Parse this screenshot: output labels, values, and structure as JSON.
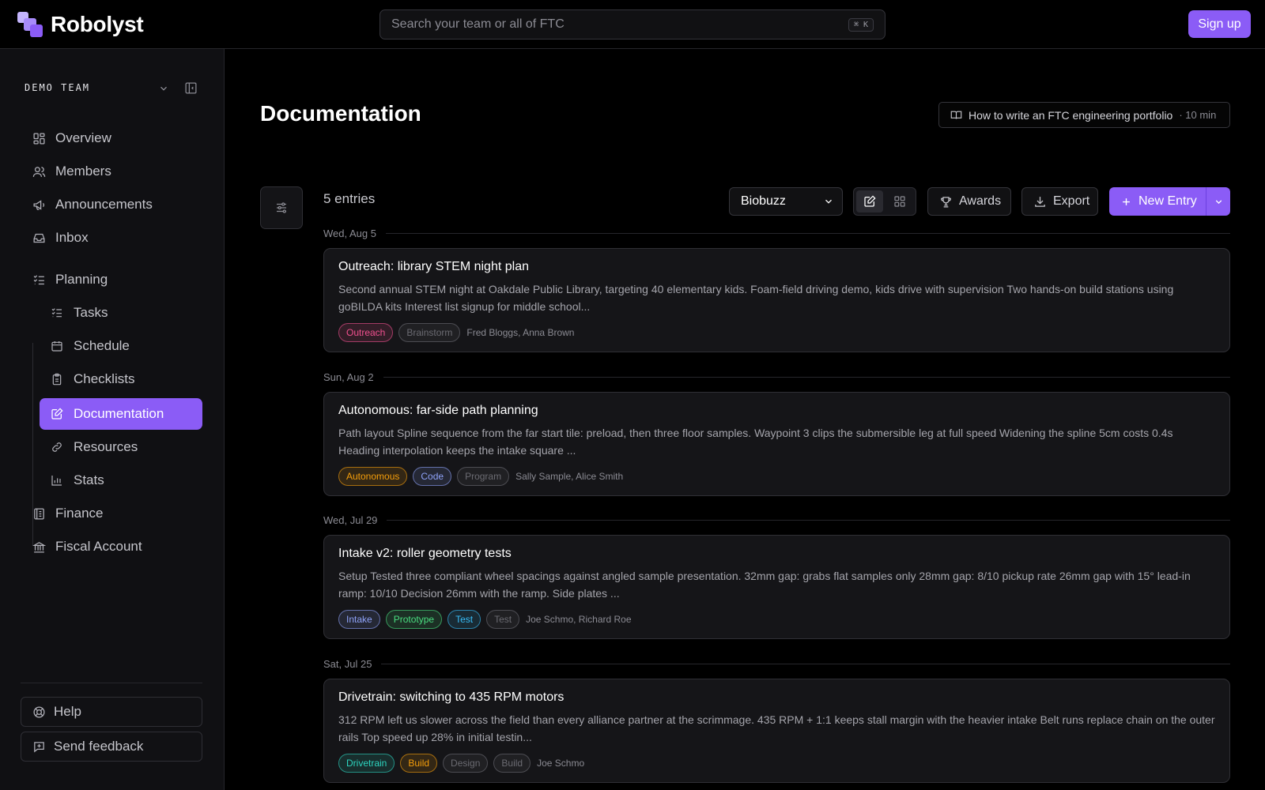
{
  "app": {
    "name": "Robolyst"
  },
  "search": {
    "placeholder": "Search your team or all of FTC",
    "shortcut": "⌘ K"
  },
  "header": {
    "signup_label": "Sign up"
  },
  "sidebar": {
    "team_name": "DEMO TEAM",
    "items": [
      {
        "key": "overview",
        "label": "Overview",
        "icon": "grid-icon"
      },
      {
        "key": "members",
        "label": "Members",
        "icon": "users-icon"
      },
      {
        "key": "announcements",
        "label": "Announcements",
        "icon": "megaphone-icon"
      },
      {
        "key": "inbox",
        "label": "Inbox",
        "icon": "inbox-icon"
      },
      {
        "key": "planning",
        "label": "Planning",
        "icon": "list-check-icon"
      },
      {
        "key": "tasks",
        "label": "Tasks",
        "icon": "list-check-icon"
      },
      {
        "key": "schedule",
        "label": "Schedule",
        "icon": "calendar-icon"
      },
      {
        "key": "checklists",
        "label": "Checklists",
        "icon": "clipboard-icon"
      },
      {
        "key": "documentation",
        "label": "Documentation",
        "icon": "edit-icon",
        "active": true
      },
      {
        "key": "resources",
        "label": "Resources",
        "icon": "link-icon"
      },
      {
        "key": "stats",
        "label": "Stats",
        "icon": "bar-chart-icon"
      },
      {
        "key": "finance",
        "label": "Finance",
        "icon": "ledger-icon"
      },
      {
        "key": "fiscal",
        "label": "Fiscal Account",
        "icon": "bank-icon"
      }
    ],
    "help_label": "Help",
    "feedback_label": "Send feedback"
  },
  "main": {
    "title": "Documentation",
    "guide": {
      "label": "How to write an FTC engineering portfolio",
      "duration": "· 10 min"
    },
    "entries_count": "5 entries",
    "season_select": {
      "value": "Biobuzz"
    },
    "toolbar": {
      "awards_label": "Awards",
      "export_label": "Export",
      "new_entry_label": "New Entry"
    },
    "groups": [
      {
        "date": "Wed, Aug 5",
        "entry": {
          "title": "Outreach: library STEM night plan",
          "body": "Second annual STEM night at Oakdale Public Library, targeting 40 elementary kids. Foam-field driving demo, kids drive with supervision Two hands-on build stations using goBILDA kits Interest list signup for middle school...",
          "tags": [
            {
              "label": "Outreach",
              "color": "#f0508f"
            },
            {
              "label": "Brainstorm",
              "color": "#6b6b72"
            }
          ],
          "people": "Fred Bloggs, Anna Brown"
        }
      },
      {
        "date": "Sun, Aug 2",
        "entry": {
          "title": "Autonomous: far-side path planning",
          "body": "Path layout Spline sequence from the far start tile: preload, then three floor samples. Waypoint 3 clips the submersible leg at full speed Widening the spline 5cm costs 0.4s Heading interpolation keeps the intake square ...",
          "tags": [
            {
              "label": "Autonomous",
              "color": "#f59e0b"
            },
            {
              "label": "Code",
              "color": "#8ea2f8"
            },
            {
              "label": "Program",
              "color": "#6b6b72"
            }
          ],
          "people": "Sally Sample, Alice Smith"
        }
      },
      {
        "date": "Wed, Jul 29",
        "entry": {
          "title": "Intake v2: roller geometry tests",
          "body": "Setup Tested three compliant wheel spacings against angled sample presentation. 32mm gap: grabs flat samples only 28mm gap: 8/10 pickup rate 26mm gap with 15° lead-in ramp: 10/10 Decision 26mm with the ramp. Side plates ...",
          "tags": [
            {
              "label": "Intake",
              "color": "#8ea2f8"
            },
            {
              "label": "Prototype",
              "color": "#4ade80"
            },
            {
              "label": "Test",
              "color": "#38bdf8"
            },
            {
              "label": "Test",
              "color": "#6b6b72"
            }
          ],
          "people": "Joe Schmo, Richard Roe"
        }
      },
      {
        "date": "Sat, Jul 25",
        "entry": {
          "title": "Drivetrain: switching to 435 RPM motors",
          "body": "312 RPM left us slower across the field than every alliance partner at the scrimmage. 435 RPM + 1:1 keeps stall margin with the heavier intake Belt runs replace chain on the outer rails Top speed up 28% in initial testin...",
          "tags": [
            {
              "label": "Drivetrain",
              "color": "#2dd4bf"
            },
            {
              "label": "Build",
              "color": "#f59e0b"
            },
            {
              "label": "Design",
              "color": "#6b6b72"
            },
            {
              "label": "Build",
              "color": "#6b6b72"
            }
          ],
          "people": "Joe Schmo"
        }
      }
    ]
  },
  "colors": {
    "accent": "#8b5cf6",
    "background": "#000000",
    "sidebar": "#101013",
    "card": "#151518"
  }
}
